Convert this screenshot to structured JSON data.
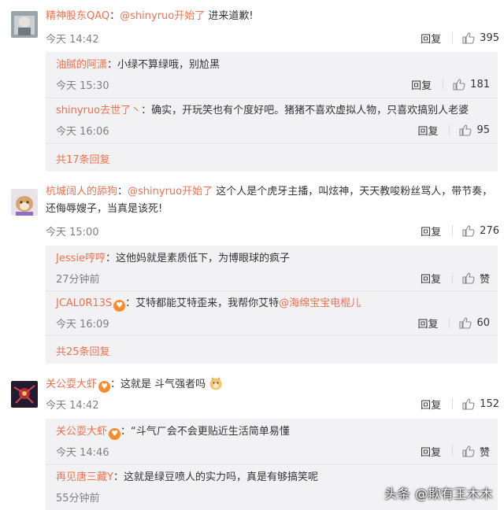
{
  "comments": [
    {
      "user": "精神股东QAQ",
      "mention": "@shinyruo开始了",
      "text": "进来道歉!",
      "time": "今天 14:42",
      "reply_label": "回复",
      "likes": "395",
      "replies": [
        {
          "user": "油腻的阿潇",
          "text": "：小绿不算绿哦，别尬黑",
          "time": "今天 15:30",
          "reply_label": "回复",
          "likes": "181"
        },
        {
          "user": "shinyruo去世了丶",
          "text": "：确实，开玩笑也有个度好吧。猪猪不喜欢虚拟人物，只喜欢搞别人老婆",
          "time": "今天 16:06",
          "reply_label": "回复",
          "likes": "95"
        }
      ],
      "more_replies": "共17条回复"
    },
    {
      "user": "杭城阔人的舔狗",
      "mention": "@shinyruo开始了",
      "text": "这个人是个虎牙主播，叫炫神，天天教唆粉丝骂人，带节奏，还侮辱嫂子，当真是该死!",
      "time": "今天 15:00",
      "reply_label": "回复",
      "likes": "276",
      "replies": [
        {
          "user": "Jessie哼哼",
          "text": "：这他妈就是素质低下，为博眼球的疯子",
          "time": "27分钟前",
          "reply_label": "回复",
          "likes": "赞"
        },
        {
          "user": "JCAL0R13S",
          "badge": "心",
          "text": "：艾特都能艾特歪来，我帮你艾特",
          "mention": "@海绵宝宝电棍儿",
          "time": "今天 16:09",
          "reply_label": "回复",
          "likes": "60"
        }
      ],
      "more_replies": "共25条回复"
    },
    {
      "user": "关公耍大虾",
      "badge": "心",
      "text": "：这就是 斗气强者吗",
      "time": "今天 14:42",
      "reply_label": "回复",
      "likes": "152",
      "replies": [
        {
          "user": "关公耍大虾",
          "badge": "心",
          "text": "：“斗气ㄏ会不会更贴近生活简单易懂",
          "time": "今天 14:46",
          "reply_label": "回复",
          "likes": "赞"
        },
        {
          "user": "再见唐三藏Y",
          "text": "：这就是绿豆喷人的实力吗，真是有够搞笑呢",
          "time": "55分钟前",
          "reply_label": "",
          "likes": ""
        }
      ]
    }
  ],
  "watermark": "头条 @欺有王木木",
  "colors": {
    "accent": "#eb7350",
    "reply_bg": "#f2f2f5",
    "time": "#808080"
  },
  "icons": {
    "like": "thumbs-up-icon",
    "badge": "heart-badge-icon",
    "emoji": "doge-emoji-icon"
  }
}
